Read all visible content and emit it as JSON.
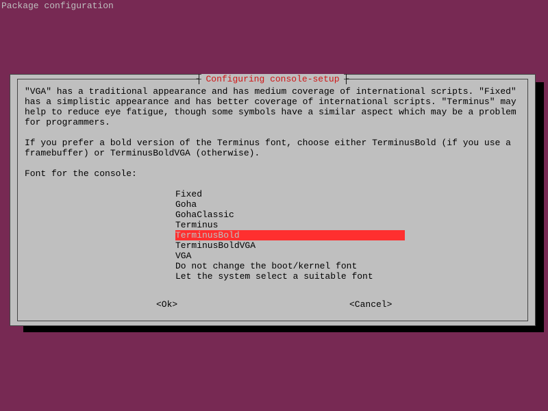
{
  "header": "Package configuration",
  "dialog": {
    "title": "Configuring console-setup",
    "paragraph1": "\"VGA\" has a traditional appearance and has medium coverage of international scripts. \"Fixed\" has a simplistic appearance and has better coverage of international scripts. \"Terminus\" may help to reduce eye fatigue, though some symbols have a similar aspect which may be a problem for programmers.",
    "paragraph2": "If you prefer a bold version of the Terminus font, choose either TerminusBold (if you use a framebuffer) or TerminusBoldVGA (otherwise).",
    "prompt": "Font for the console:",
    "options": [
      "Fixed",
      "Goha",
      "GohaClassic",
      "Terminus",
      "TerminusBold",
      "TerminusBoldVGA",
      "VGA",
      "Do not change the boot/kernel font",
      "Let the system select a suitable font"
    ],
    "selected_index": 4,
    "ok_label": "<Ok>",
    "cancel_label": "<Cancel>"
  }
}
